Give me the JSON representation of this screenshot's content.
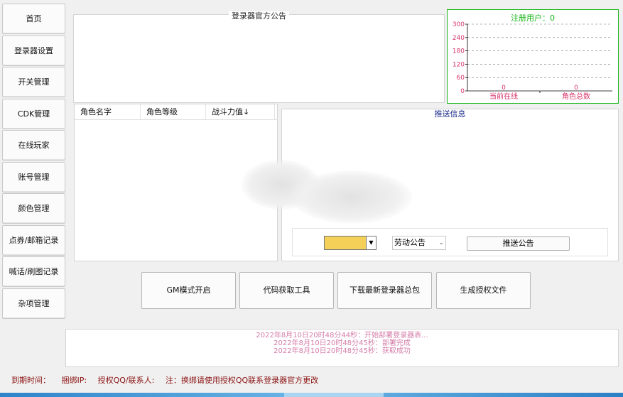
{
  "sidebar": {
    "items": [
      {
        "label": "首页"
      },
      {
        "label": "登录器设置"
      },
      {
        "label": "开关管理"
      },
      {
        "label": "CDK管理"
      },
      {
        "label": "在线玩家"
      },
      {
        "label": "账号管理"
      },
      {
        "label": "颜色管理"
      },
      {
        "label": "点券/邮箱记录"
      },
      {
        "label": "喊话/刷图记录"
      },
      {
        "label": "杂项管理"
      }
    ]
  },
  "notice": {
    "title": "登录器官方公告"
  },
  "stats": {
    "title": "注册用户：0",
    "colors": {
      "border": "#19b719",
      "title": "#16b616",
      "axis": "#d6336c"
    }
  },
  "chart_data": {
    "type": "bar",
    "title": "注册用户：0",
    "categories": [
      "当前在线",
      "角色总数"
    ],
    "values": [
      0,
      0
    ],
    "ylim": [
      0,
      300
    ],
    "yticks": [
      0,
      60,
      120,
      180,
      240,
      300
    ],
    "grid": true,
    "value_labels": [
      "0",
      "0"
    ]
  },
  "roles_table": {
    "columns": [
      "角色名字",
      "角色等级",
      "战斗力值↓"
    ],
    "rows": []
  },
  "push": {
    "title": "推送信息",
    "input_value": "",
    "select_value": "劳动公告",
    "send_label": "推送公告"
  },
  "actions": {
    "gm_mode": "GM模式开启",
    "code_tool": "代码获取工具",
    "download_package": "下载最新登录器总包",
    "generate_license": "生成授权文件"
  },
  "log": {
    "lines": [
      "2022年8月10日20时48分44秒：开始部署登录器表...",
      "2022年8月10日20时48分45秒：部署完成",
      "2022年8月10日20时48分45秒：获取成功"
    ]
  },
  "footer": {
    "expiry": "到期时间：",
    "bind_ip": "捆绑IP:",
    "license_qq": "授权QQ/联系人:",
    "note": "注：换绑请使用授权QQ联系登录器官方更改"
  }
}
